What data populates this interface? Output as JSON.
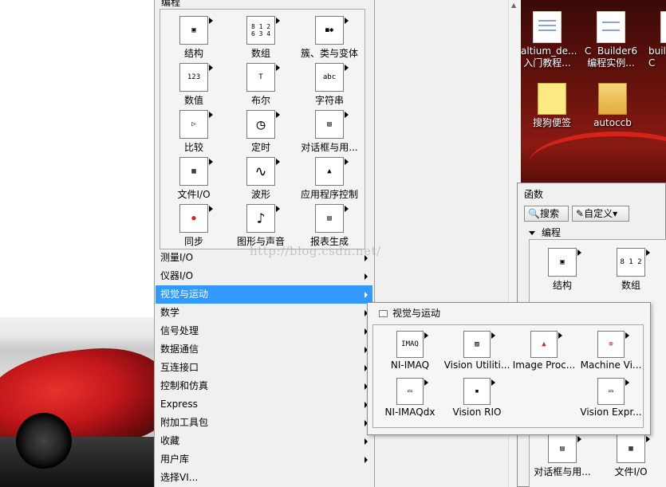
{
  "palette_title": "编程",
  "palette": [
    {
      "label": "结构",
      "icon": "structure-icon",
      "glyph": "▣"
    },
    {
      "label": "数组",
      "icon": "array-icon",
      "glyph": "8 1 2\n6 3 4"
    },
    {
      "label": "簇、类与变体",
      "icon": "cluster-icon",
      "glyph": "◼◆"
    },
    {
      "label": "数值",
      "icon": "numeric-icon",
      "glyph": "123"
    },
    {
      "label": "布尔",
      "icon": "boolean-icon",
      "glyph": "T"
    },
    {
      "label": "字符串",
      "icon": "string-icon",
      "glyph": "abc"
    },
    {
      "label": "比较",
      "icon": "comparison-icon",
      "glyph": "▷"
    },
    {
      "label": "定时",
      "icon": "timing-icon",
      "glyph": "◷"
    },
    {
      "label": "对话框与用...",
      "icon": "dialog-icon",
      "glyph": "▤"
    },
    {
      "label": "文件I/O",
      "icon": "file-io-icon",
      "glyph": "▦"
    },
    {
      "label": "波形",
      "icon": "waveform-icon",
      "glyph": "∿"
    },
    {
      "label": "应用程序控制",
      "icon": "app-control-icon",
      "glyph": "▲"
    },
    {
      "label": "同步",
      "icon": "sync-icon",
      "glyph": "●"
    },
    {
      "label": "图形与声音",
      "icon": "graphics-sound-icon",
      "glyph": "♪"
    },
    {
      "label": "报表生成",
      "icon": "report-icon",
      "glyph": "▤"
    }
  ],
  "menu_items": [
    {
      "label": "测量I/O",
      "active": false
    },
    {
      "label": "仪器I/O",
      "active": false
    },
    {
      "label": "视觉与运动",
      "active": true
    },
    {
      "label": "数学",
      "active": false
    },
    {
      "label": "信号处理",
      "active": false
    },
    {
      "label": "数据通信",
      "active": false
    },
    {
      "label": "互连接口",
      "active": false
    },
    {
      "label": "控制和仿真",
      "active": false
    },
    {
      "label": "Express",
      "active": false
    },
    {
      "label": "附加工具包",
      "active": false
    },
    {
      "label": "收藏",
      "active": false
    },
    {
      "label": "用户库",
      "active": false
    },
    {
      "label": "选择VI...",
      "active": false
    }
  ],
  "submenu": {
    "title": "视觉与运动",
    "items": [
      {
        "label": "NI-IMAQ",
        "icon": "ni-imaq-icon",
        "glyph": "IMAQ"
      },
      {
        "label": "Vision Utiliti...",
        "icon": "vision-utilities-icon",
        "glyph": "▨"
      },
      {
        "label": "Image Proc...",
        "icon": "image-processing-icon",
        "glyph": "▲"
      },
      {
        "label": "Machine Vi...",
        "icon": "machine-vision-icon",
        "glyph": "⊕"
      },
      {
        "label": "NI-IMAQdx",
        "icon": "ni-imaqdx-icon",
        "glyph": "▭"
      },
      {
        "label": "Vision RIO",
        "icon": "vision-rio-icon",
        "glyph": "▪"
      },
      {
        "label": "Vision Expr...",
        "icon": "vision-express-icon",
        "glyph": "▭"
      }
    ]
  },
  "watermark": "http://blog.csdn.net/",
  "functions_window": {
    "title": "函数",
    "search_label": "搜索",
    "customize_label": "自定义▾",
    "section_label": "编程",
    "items": [
      {
        "label": "结构",
        "icon": "structure-icon",
        "glyph": "▣"
      },
      {
        "label": "数组",
        "icon": "array-icon",
        "glyph": "8 1 2"
      },
      {
        "label": "对话框与用...",
        "icon": "dialog-icon",
        "glyph": "▤"
      },
      {
        "label": "文件I/O",
        "icon": "file-io-icon",
        "glyph": "▦"
      }
    ]
  },
  "desktop_icons": [
    {
      "label": "altium_de...\n入门教程...",
      "icon": "document-icon"
    },
    {
      "label": "C  Builder6\n编程实例...",
      "icon": "document-icon"
    },
    {
      "label": "buil\nC",
      "icon": "document-icon"
    },
    {
      "label": "搜狗便签",
      "icon": "note-icon"
    },
    {
      "label": "autoccb",
      "icon": "folder-icon"
    }
  ]
}
